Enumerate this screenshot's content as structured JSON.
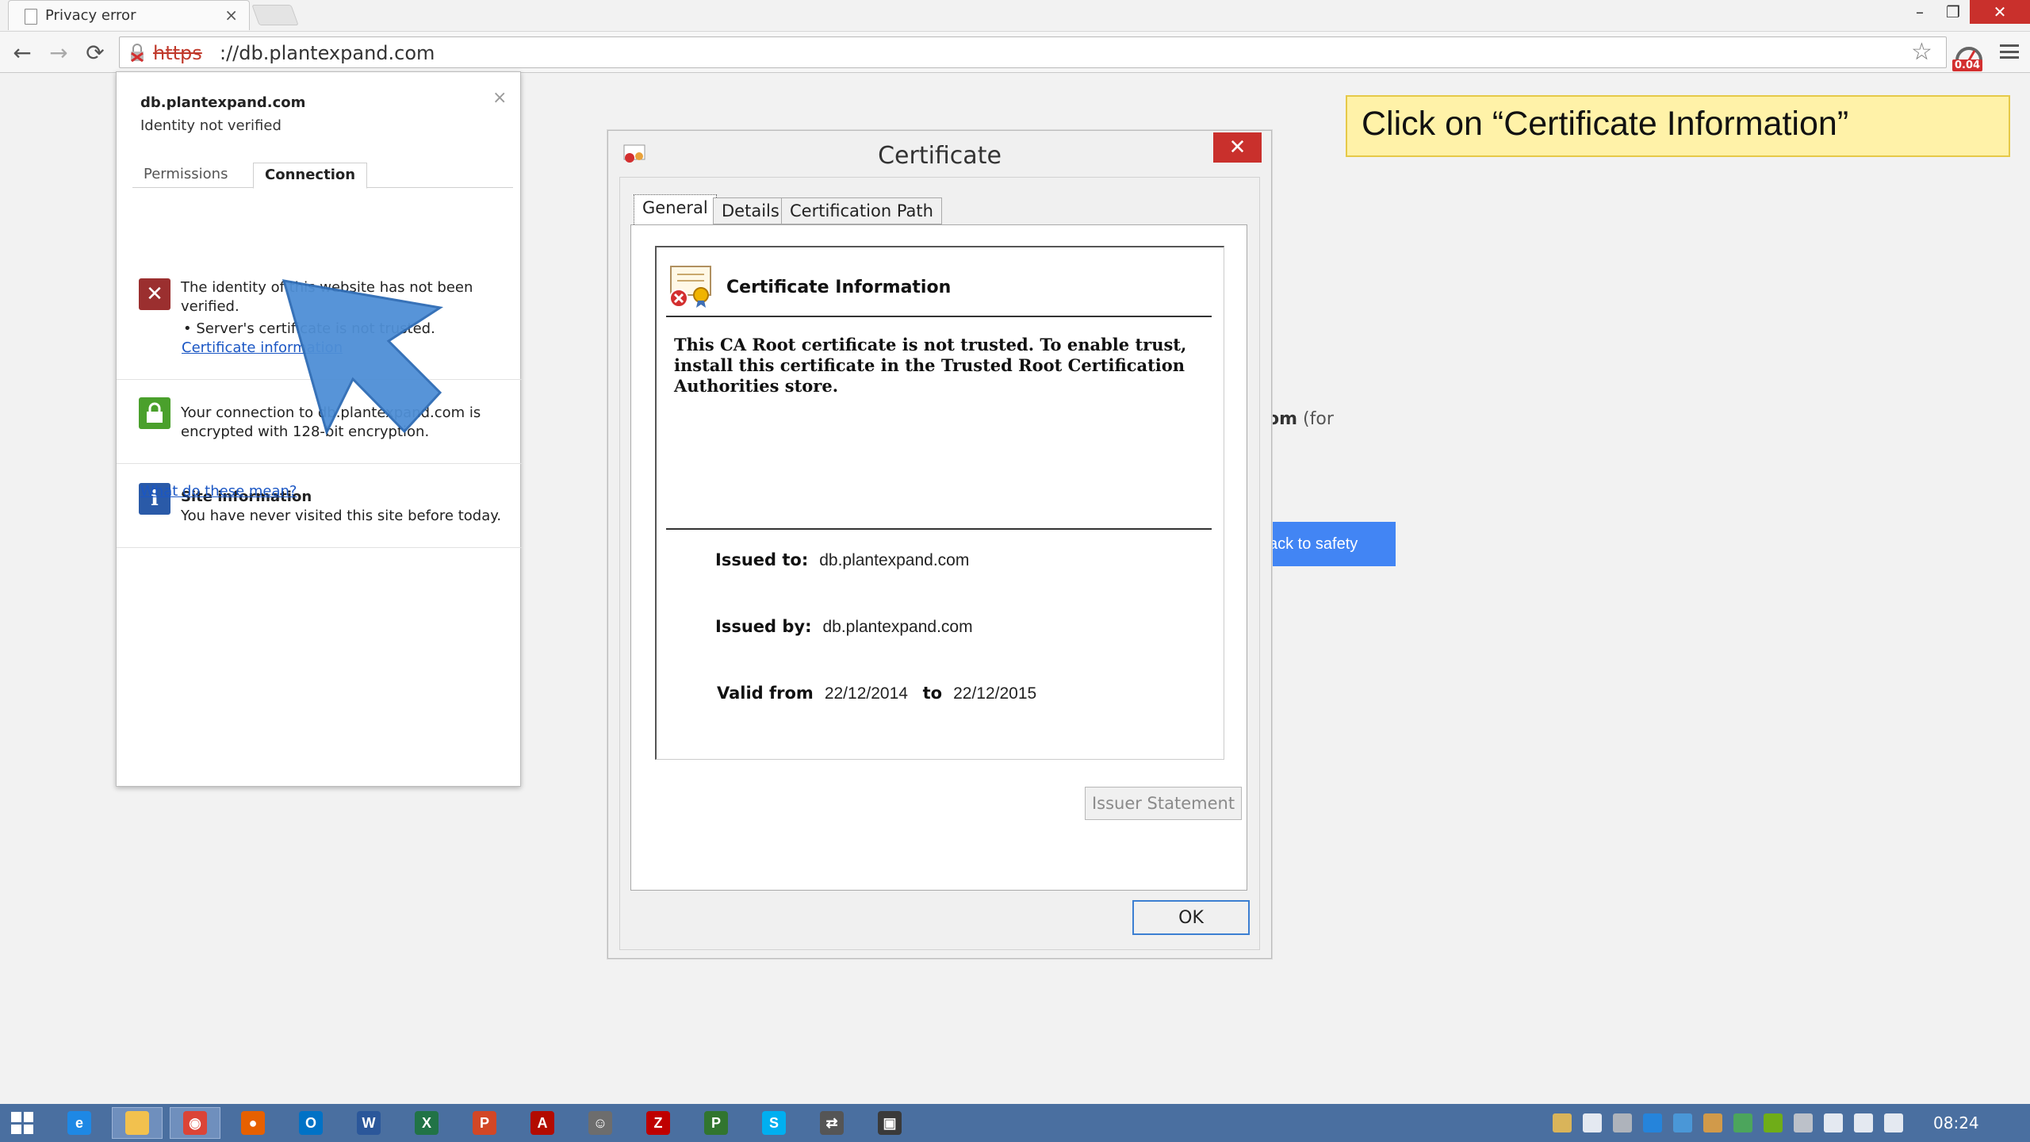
{
  "browser": {
    "tab_title": "Privacy error",
    "tab_close": "×",
    "url_scheme": "https",
    "url_rest": "://db.plantexpand.com",
    "ext_badge": "0.04",
    "window_min": "–",
    "window_max": "❐",
    "window_close": "✕"
  },
  "page": {
    "fragment_bold": "om",
    "fragment_rest": " (for",
    "back_button": "ack to safety"
  },
  "annotation": {
    "text": "Click on “Certificate Information”"
  },
  "site_info": {
    "domain": "db.plantexpand.com",
    "identity": "Identity not verified",
    "close": "×",
    "tab_permissions": "Permissions",
    "tab_connection": "Connection",
    "identity_msg": "The identity of this website has not been verified.",
    "bullet": "• Server's certificate is not trusted.",
    "cert_link": "Certificate information",
    "connection_msg": "Your connection to db.plantexpand.com is encrypted with 128-bit encryption.",
    "site_title": "Site information",
    "site_desc": "You have never visited this site before today.",
    "help_link": "What do these mean?"
  },
  "certificate": {
    "title": "Certificate",
    "close": "✕",
    "tabs": [
      "General",
      "Details",
      "Certification Path"
    ],
    "info_title": "Certificate Information",
    "warning": "This CA Root certificate is not trusted. To enable trust, install this certificate in the Trusted Root Certification Authorities store.",
    "issued_to_label": "Issued to:",
    "issued_to_value": "db.plantexpand.com",
    "issued_by_label": "Issued by:",
    "issued_by_value": "db.plantexpand.com",
    "valid_from_label": "Valid from",
    "valid_from": "22/12/2014",
    "valid_to_label": "to",
    "valid_to": "22/12/2015",
    "issuer_statement": "Issuer Statement",
    "ok": "OK"
  },
  "taskbar": {
    "clock": "08:24",
    "apps": [
      {
        "name": "internet-explorer",
        "color": "#1e88e5",
        "glyph": "e"
      },
      {
        "name": "file-explorer",
        "color": "#f2c14e",
        "glyph": ""
      },
      {
        "name": "chrome",
        "color": "#db4437",
        "glyph": "◉"
      },
      {
        "name": "firefox",
        "color": "#e66000",
        "glyph": "●"
      },
      {
        "name": "outlook",
        "color": "#0072c6",
        "glyph": "O"
      },
      {
        "name": "word",
        "color": "#2b579a",
        "glyph": "W"
      },
      {
        "name": "excel",
        "color": "#217346",
        "glyph": "X"
      },
      {
        "name": "powerpoint",
        "color": "#d24726",
        "glyph": "P"
      },
      {
        "name": "acrobat",
        "color": "#b30b00",
        "glyph": "A"
      },
      {
        "name": "gimp",
        "color": "#6d6d6d",
        "glyph": "☺"
      },
      {
        "name": "filezilla",
        "color": "#bf0000",
        "glyph": "Z"
      },
      {
        "name": "project",
        "color": "#31752f",
        "glyph": "P"
      },
      {
        "name": "skype",
        "color": "#00aff0",
        "glyph": "S"
      },
      {
        "name": "network-tool",
        "color": "#555555",
        "glyph": "⇄"
      },
      {
        "name": "terminal",
        "color": "#3a3a3a",
        "glyph": "▣"
      }
    ],
    "tray_colors": [
      "#f2c14e",
      "#ffffff",
      "#c0c0c0",
      "#1e88e5",
      "#4a9fe0",
      "#e9a23b",
      "#4caf50",
      "#76b900",
      "#d0d0d0",
      "#ffffff",
      "#ffffff",
      "#ffffff"
    ]
  }
}
